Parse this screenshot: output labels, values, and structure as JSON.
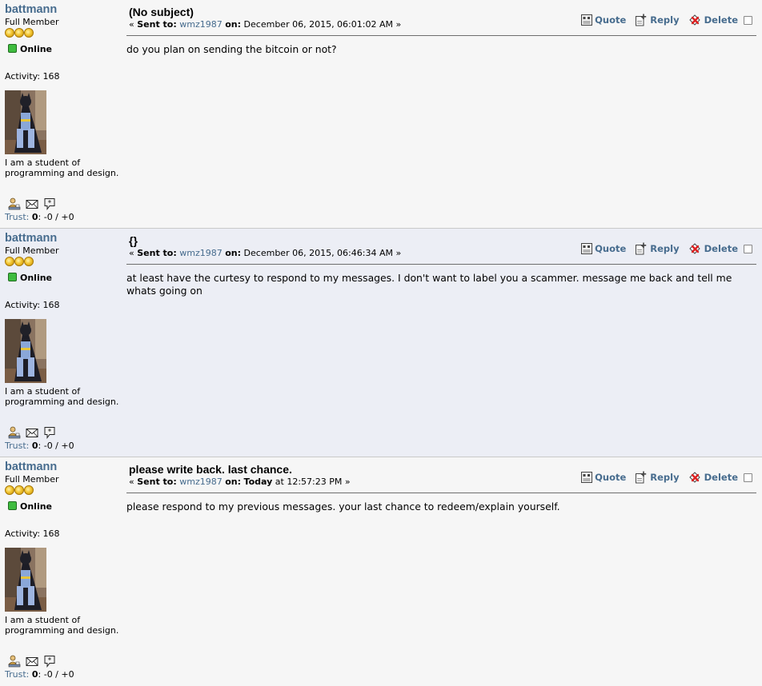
{
  "messages": [
    {
      "poster": {
        "username": "battmann",
        "rank": "Full Member",
        "status": "Online",
        "activity": "Activity: 168",
        "bio": "I am a student of programming and design.",
        "trust_label": "Trust:",
        "trust_score": "0",
        "trust_rest": ": -0 / +0"
      },
      "subject": "(No subject)",
      "meta": {
        "prefix": "« ",
        "sent_to_label": "Sent to:",
        "recipient": "wmz1987",
        "on_label": "on:",
        "date": "December 06, 2015, 06:01:02 AM",
        "suffix": " »"
      },
      "actions": {
        "quote": "Quote",
        "reply": "Reply",
        "delete": "Delete"
      },
      "body": "do you plan on sending the bitcoin or not?"
    },
    {
      "poster": {
        "username": "battmann",
        "rank": "Full Member",
        "status": "Online",
        "activity": "Activity: 168",
        "bio": "I am a student of programming and design.",
        "trust_label": "Trust:",
        "trust_score": "0",
        "trust_rest": ": -0 / +0"
      },
      "subject": "{}",
      "meta": {
        "prefix": "« ",
        "sent_to_label": "Sent to:",
        "recipient": "wmz1987",
        "on_label": "on:",
        "date": "December 06, 2015, 06:46:34 AM",
        "suffix": " »"
      },
      "actions": {
        "quote": "Quote",
        "reply": "Reply",
        "delete": "Delete"
      },
      "body": "at least have the curtesy to respond to my messages. I don't want to label you a scammer. message me back and tell me whats going on"
    },
    {
      "poster": {
        "username": "battmann",
        "rank": "Full Member",
        "status": "Online",
        "activity": "Activity: 168",
        "bio": "I am a student of programming and design.",
        "trust_label": "Trust:",
        "trust_score": "0",
        "trust_rest": ": -0 / +0"
      },
      "subject": "please write back. last chance.",
      "meta": {
        "prefix": "« ",
        "sent_to_label": "Sent to:",
        "recipient": "wmz1987",
        "on_label": "on:",
        "date_bold": "Today",
        "date": " at 12:57:23 PM",
        "suffix": " »"
      },
      "actions": {
        "quote": "Quote",
        "reply": "Reply",
        "delete": "Delete"
      },
      "body": "please respond to my previous messages. your last chance to redeem/explain yourself."
    }
  ],
  "icons": {
    "profile": [
      "profile-icon",
      "envelope-icon",
      "speech-bubble-icon"
    ],
    "actions": [
      "quote-icon",
      "reply-icon",
      "delete-icon"
    ]
  },
  "colors": {
    "link": "#476c8e",
    "row_alt": "#eceef5",
    "online": "#3fbc3f"
  }
}
